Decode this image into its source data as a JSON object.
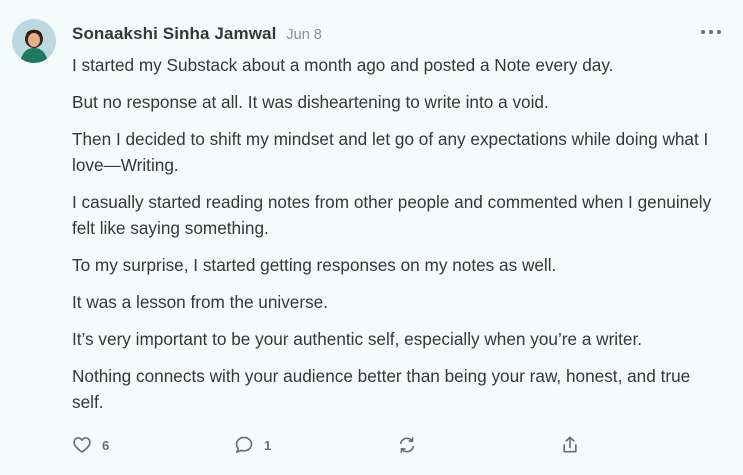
{
  "note": {
    "author": "Sonaakshi Sinha Jamwal",
    "date": "Jun 8",
    "paragraphs": [
      "I started my Substack about a month ago and posted a Note every day.",
      "But no response at all. It was disheartening to write into a void.",
      "Then I decided to shift my mindset and let go of any expectations while doing what I love—Writing.",
      "I casually started reading notes from other people and commented when I genuinely felt like saying something.",
      "To my surprise, I started getting responses on my notes as well.",
      "It was a lesson from the universe.",
      "It’s very important to be your authentic self, especially when you’re a writer.",
      "Nothing connects with your audience better than being your raw, honest, and true self."
    ],
    "actions": {
      "like_count": "6",
      "comment_count": "1"
    }
  },
  "icons": {
    "like": "heart-icon",
    "comment": "comment-bubble-icon",
    "restack": "restack-icon",
    "share": "share-icon",
    "more": "more-options-icon"
  },
  "colors": {
    "background": "#f4fbfb",
    "text": "#363737",
    "muted": "#8a8f90"
  }
}
